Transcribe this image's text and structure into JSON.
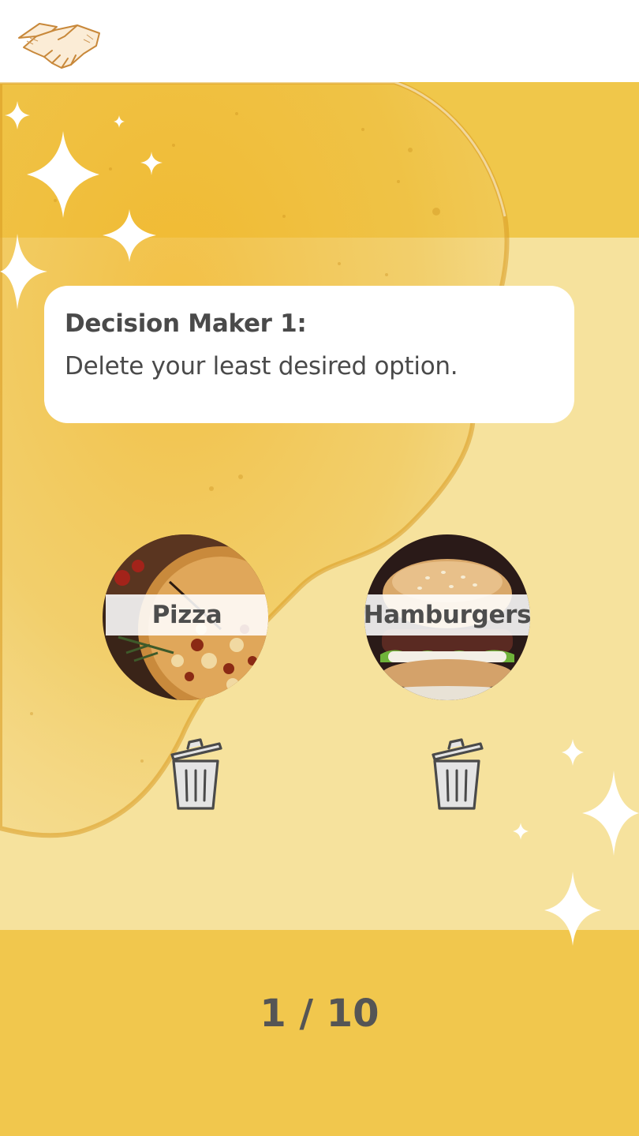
{
  "header": {
    "logo_icon": "handshake-icon"
  },
  "card": {
    "title": "Decision Maker 1:",
    "instruction": "Delete your least desired option."
  },
  "options": [
    {
      "label": "Pizza",
      "image": "pizza-image",
      "delete_icon": "trash-icon"
    },
    {
      "label": "Hamburgers",
      "image": "hamburger-image",
      "delete_icon": "trash-icon"
    }
  ],
  "footer": {
    "progress": "1 / 10"
  },
  "colors": {
    "band": "#f0c74a",
    "background": "#f6e29d",
    "footer": "#f1c74d",
    "text": "#4a4a4a"
  }
}
